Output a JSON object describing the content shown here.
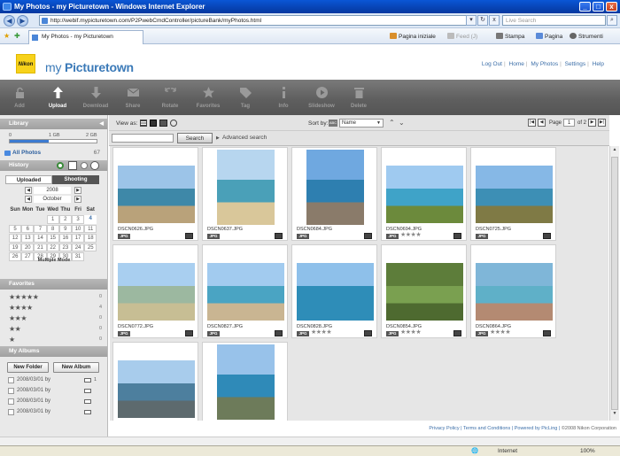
{
  "window": {
    "title": "My Photos - my Picturetown - Windows Internet Explorer",
    "min": "_",
    "max": "□",
    "close": "x"
  },
  "address": {
    "url": "http://webif.mypicturetown.com/P2PwebCmdController/pictureBank/myPhotos.html",
    "search_placeholder": "Live Search",
    "back": "◀",
    "forward": "▶",
    "go": "→",
    "refresh": "↻",
    "stop": "x",
    "dropdown": "▾",
    "search_btn": "🔍"
  },
  "tabbar": {
    "tab_label": "My Photos - my Picturetown",
    "commands": {
      "home": "Pagina iniziale",
      "feeds": "Feed (J)",
      "print": "Stampa",
      "page": "Pagina",
      "tools": "Strumenti"
    }
  },
  "header": {
    "logo_text": "Nikon",
    "brand_prefix": "my ",
    "brand_main": "Picturetown",
    "links": [
      "Log Out",
      "Home",
      "My Photos",
      "Settings",
      "Help"
    ]
  },
  "toolbar": {
    "items": [
      {
        "label": "Add",
        "icon": "lock-icon"
      },
      {
        "label": "Upload",
        "icon": "upload-arrow-icon"
      },
      {
        "label": "Download",
        "icon": "download-arrow-icon"
      },
      {
        "label": "Share",
        "icon": "envelope-icon"
      },
      {
        "label": "Rotate",
        "icon": "rotate-icon"
      },
      {
        "label": "Favorites",
        "icon": "star-icon"
      },
      {
        "label": "Tag",
        "icon": "tag-icon"
      },
      {
        "label": "Info",
        "icon": "info-icon"
      },
      {
        "label": "Slideshow",
        "icon": "slideshow-icon"
      },
      {
        "label": "Delete",
        "icon": "trash-icon"
      }
    ]
  },
  "sidebar": {
    "library_title": "Library",
    "storage": {
      "min": "0",
      "mid": "1 GB",
      "max": "2 GB",
      "used_fraction": 0.45
    },
    "all_photos": {
      "label": "All Photos",
      "count": "67"
    },
    "history_title": "History",
    "tabs": {
      "uploaded": "Uploaded",
      "shooting": "Shooting"
    },
    "year": "2008",
    "month": "October",
    "weekdays": [
      "Sun",
      "Mon",
      "Tue",
      "Wed",
      "Thu",
      "Fri",
      "Sat"
    ],
    "weeks": [
      [
        "",
        "",
        "",
        "1",
        "2",
        "3",
        "4"
      ],
      [
        "5",
        "6",
        "7",
        "8",
        "9",
        "10",
        "11"
      ],
      [
        "12",
        "13",
        "14",
        "15",
        "16",
        "17",
        "18"
      ],
      [
        "19",
        "20",
        "21",
        "22",
        "23",
        "24",
        "25"
      ],
      [
        "26",
        "27",
        "28",
        "29",
        "30",
        "31",
        ""
      ]
    ],
    "multiple_mode": "Multiple Mode",
    "favorites_title": "Favorites",
    "favorites": [
      {
        "stars": "★★★★★",
        "count": "0"
      },
      {
        "stars": "★★★★",
        "count": "4"
      },
      {
        "stars": "★★★",
        "count": "0"
      },
      {
        "stars": "★★",
        "count": "0"
      },
      {
        "stars": "★",
        "count": "0"
      }
    ],
    "albums_title": "My Albums",
    "new_folder": "New Folder",
    "new_album": "New Album",
    "albums": [
      {
        "title": "2008/03/01 by",
        "count": "1"
      },
      {
        "title": "2008/03/01 by",
        "count": ""
      },
      {
        "title": "2008/03/01 by",
        "count": ""
      },
      {
        "title": "2008/03/01 by",
        "count": ""
      }
    ]
  },
  "viewbar": {
    "view_as": "View as:",
    "sort_by": "Sort by:",
    "sort_value": "Name",
    "page_label": "Page",
    "page_current": "1",
    "page_total": "of 2",
    "search_button": "Search",
    "advanced_search": "Advanced search"
  },
  "photos": [
    {
      "name": "DSCN0626.JPG",
      "badge": "JPG",
      "stars": "",
      "shape": "landscape",
      "sky": "#9cc4e8",
      "sea": "#3e88a8",
      "land": "#b9a27a"
    },
    {
      "name": "DSCN0637.JPG",
      "badge": "JPG",
      "stars": "",
      "shape": "portrait",
      "sky": "#b7d6ef",
      "sea": "#4aa0b8",
      "land": "#d9c79a"
    },
    {
      "name": "DSCN0684.JPG",
      "badge": "JPG",
      "stars": "",
      "shape": "portrait",
      "sky": "#6fa8e0",
      "sea": "#2e7fb0",
      "land": "#8a7b6a"
    },
    {
      "name": "DSCN0694.JPG",
      "badge": "JPG",
      "stars": "★★★★",
      "shape": "landscape",
      "sky": "#9fcaf0",
      "sea": "#3fa3c8",
      "land": "#6c8a3c"
    },
    {
      "name": "DSCN0725.JPG",
      "badge": "JPG",
      "stars": "",
      "shape": "landscape",
      "sky": "#86b8e6",
      "sea": "#3d8fb5",
      "land": "#7f7a45"
    },
    {
      "name": "DSCN0772.JPG",
      "badge": "JPG",
      "stars": "",
      "shape": "landscape",
      "sky": "#a9cff0",
      "sea": "#9cb8a0",
      "land": "#c7be94"
    },
    {
      "name": "DSCN0827.JPG",
      "badge": "JPG",
      "stars": "",
      "shape": "landscape",
      "sky": "#a2cbef",
      "sea": "#4aa4c3",
      "land": "#c9b592"
    },
    {
      "name": "DSCN0828.JPG",
      "badge": "JPG",
      "stars": "★★★★",
      "shape": "landscape",
      "sky": "#8ec0ea",
      "sea": "#2e8db8",
      "land": "#2e8db8"
    },
    {
      "name": "DSCN0854.JPG",
      "badge": "JPG",
      "stars": "★★★★",
      "shape": "landscape",
      "sky": "#5d7d3a",
      "sea": "#7aa050",
      "land": "#4e6a30"
    },
    {
      "name": "DSCN0864.JPG",
      "badge": "JPG",
      "stars": "★★★★",
      "shape": "landscape",
      "sky": "#7fb6d8",
      "sea": "#5fb0c8",
      "land": "#b48a72"
    },
    {
      "name": "",
      "badge": "",
      "stars": "",
      "shape": "landscape",
      "sky": "#a8ccec",
      "sea": "#4d7f9e",
      "land": "#5d6a6e"
    },
    {
      "name": "",
      "badge": "",
      "stars": "",
      "shape": "portrait",
      "sky": "#98c2ea",
      "sea": "#2f8ab8",
      "land": "#6d7b5a"
    }
  ],
  "footer": {
    "links": [
      "Privacy Policy",
      "Terms and Conditions",
      "Powered by PicLing"
    ],
    "copyright": "©2008 Nikon Corporation"
  },
  "statusbar": {
    "zone": "Internet",
    "zoom": "100%"
  }
}
